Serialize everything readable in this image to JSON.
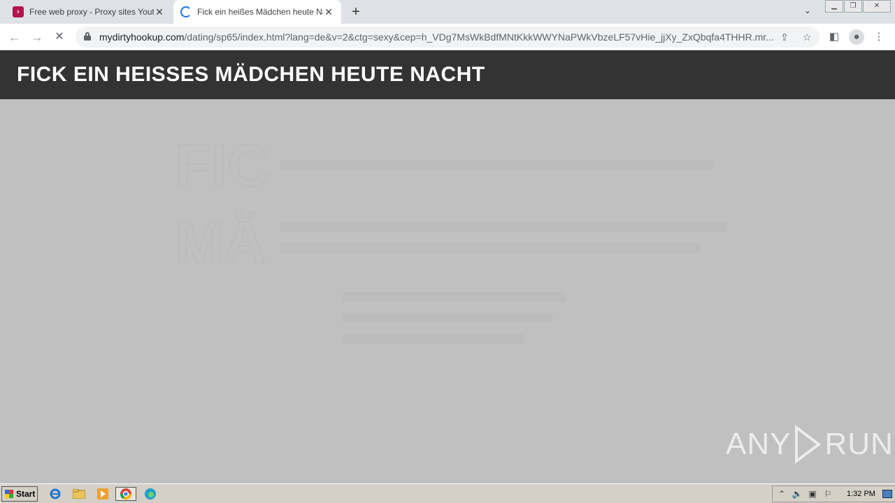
{
  "browser": {
    "tabs": [
      {
        "title": "Free web proxy - Proxy sites Youtube",
        "active": false,
        "favicon": "proxy-favicon-icon"
      },
      {
        "title": "Fick ein heißes Mädchen heute Nacht",
        "active": true,
        "favicon": "loading-spinner-icon"
      }
    ],
    "url_host": "mydirtyhookup.com",
    "url_path": "/dating/sp65/index.html?lang=de&v=2&ctg=sexy&cep=h_VDg7MsWkBdfMNtKkkWWYNaPWkVbzeLF57vHie_jjXy_ZxQbqfa4THHR.mr..."
  },
  "site": {
    "header_title": "FICK EIN HEISSES MÄDCHEN HEUTE NACHT",
    "ghost_line1": "FIC",
    "ghost_line2": "MÄ"
  },
  "watermark": {
    "left": "ANY",
    "right": "RUN"
  },
  "taskbar": {
    "start_label": "Start",
    "clock": "1:32 PM"
  },
  "colors": {
    "header_bg": "#333333",
    "content_bg": "#c0c0c0",
    "accent": "#1a73e8"
  }
}
